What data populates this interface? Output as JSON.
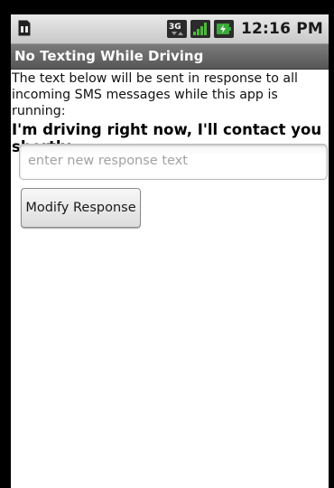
{
  "status_bar": {
    "time": "12:16 PM",
    "icons": [
      "sim-card-icon",
      "3g-data-icon",
      "signal-strength-icon",
      "battery-charging-icon"
    ]
  },
  "app": {
    "title": "No Texting While Driving"
  },
  "main": {
    "intro_text": "The text below will be sent in response to all incoming SMS messages while this app is running:",
    "response_message": "I'm driving right now, I'll contact you shortly.",
    "response_input": {
      "value": "",
      "placeholder": "enter new response text"
    },
    "modify_button_label": "Modify Response"
  },
  "colors": {
    "title_bar_bg": "#6a6a6a",
    "status_bar_bg": "#d6d6d6",
    "battery_green": "#2e9b2e",
    "signal_green": "#3c8f2e"
  }
}
